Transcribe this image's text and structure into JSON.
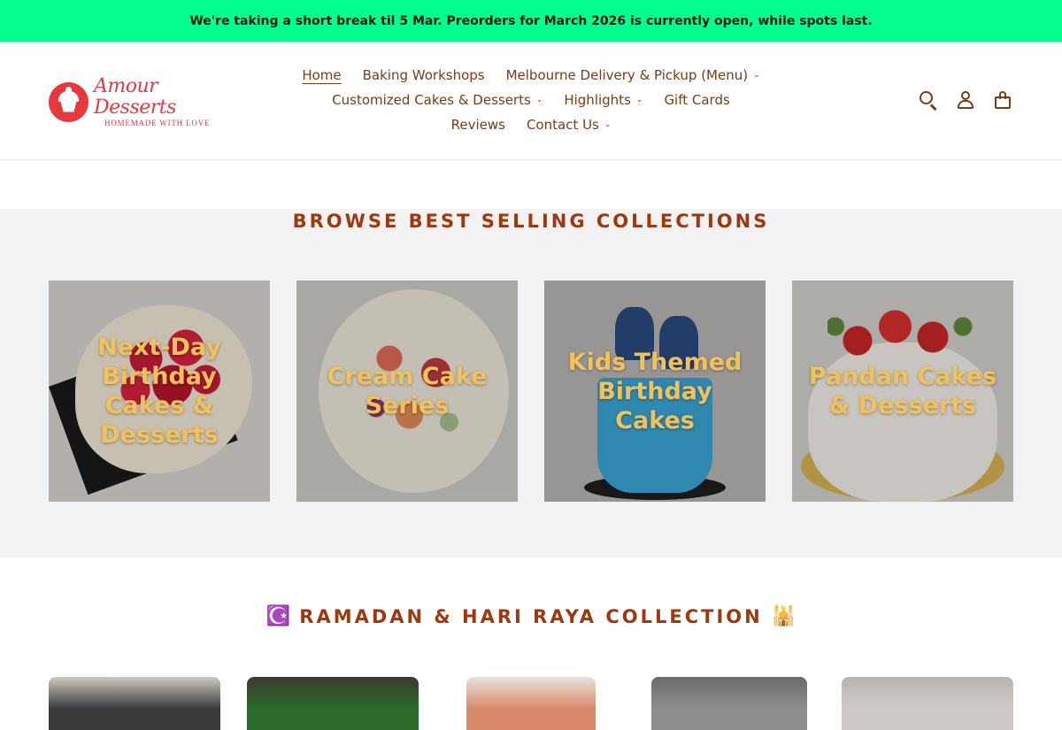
{
  "announcement": {
    "text": "We're taking a short break til 5 Mar. Preorders for March 2026 is currently open, while spots last."
  },
  "brand": {
    "name": "Amour Desserts",
    "tagline": "HOMEMADE WITH LOVE",
    "color": "#e8383d"
  },
  "nav": {
    "rows": [
      [
        {
          "label": "Home",
          "dropdown": false,
          "active": true
        },
        {
          "label": "Baking Workshops",
          "dropdown": false
        },
        {
          "label": "Melbourne Delivery & Pickup (Menu)",
          "dropdown": true
        }
      ],
      [
        {
          "label": "Customized Cakes & Desserts",
          "dropdown": true
        },
        {
          "label": "Highlights",
          "dropdown": true
        },
        {
          "label": "Gift Cards",
          "dropdown": false
        }
      ],
      [
        {
          "label": "Reviews",
          "dropdown": false
        },
        {
          "label": "Contact Us",
          "dropdown": true
        }
      ]
    ],
    "chevron": "⌄"
  },
  "header_icons": [
    "search-icon",
    "account-icon",
    "cart-icon"
  ],
  "featured": {
    "title": "BROWSE BEST SELLING COLLECTIONS",
    "collections": [
      {
        "label": "Next-Day Birthday Cakes & Desserts"
      },
      {
        "label": "Cream Cake Series"
      },
      {
        "label": "Kids Themed Birthday Cakes"
      },
      {
        "label": "Pandan Cakes & Desserts"
      }
    ]
  },
  "ramadan": {
    "emoji_left": "☪️",
    "title": "RAMADAN & HARI RAYA COLLECTION",
    "emoji_right": "🕌"
  },
  "colors": {
    "announcement_bg": "#03fe8e",
    "heading": "#a0380e",
    "nav_text": "#7b3b14",
    "collection_label": "#f2c15a",
    "featured_bg": "#f2f2f2"
  }
}
